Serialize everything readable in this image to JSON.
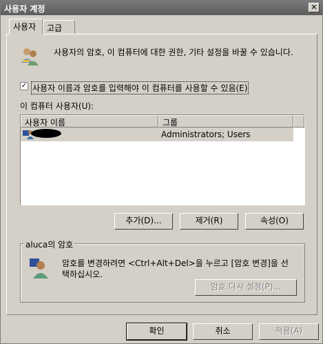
{
  "window": {
    "title": "사용자 계정",
    "close_icon": "close-icon"
  },
  "tabs": [
    {
      "label": "사용자"
    },
    {
      "label": "고급"
    }
  ],
  "intro": {
    "text": "사용자의 암호, 이 컴퓨터에 대한 권한, 기타 설정을 바꿀 수 있습니다.",
    "icon": "users-icon"
  },
  "require_login": {
    "checked": true,
    "label": "사용자 이름과 암호를 입력해야 이 컴퓨터를 사용할 수 있음(E)"
  },
  "users_label": "이 컴퓨터 사용자(U):",
  "table": {
    "columns": [
      "사용자 이름",
      "그룹"
    ],
    "rows": [
      {
        "name": "",
        "group": "Administrators; Users"
      }
    ]
  },
  "buttons": {
    "add": "추가(D)...",
    "remove": "제거(R)",
    "properties": "속성(O)"
  },
  "password_group": {
    "title": "aluca의 암호",
    "text_line1": "암호를 변경하려면 <Ctrl+Alt+Del>을 누르고 [암호 변경]을 선",
    "text_line2": "택하십시오.",
    "reset_button": "암호 다시 설정(P)...",
    "icon": "user-icon"
  },
  "footer": {
    "ok": "확인",
    "cancel": "취소",
    "apply": "적용(A)"
  }
}
